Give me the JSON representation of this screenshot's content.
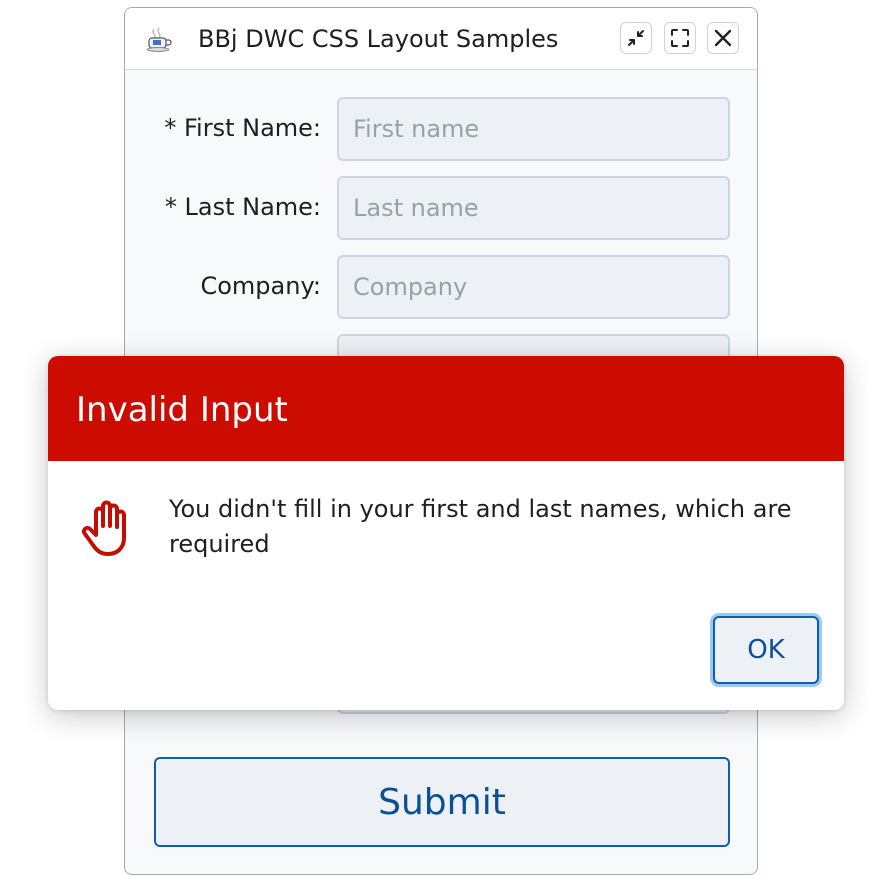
{
  "window": {
    "title": "BBj DWC CSS Layout Samples",
    "app_icon": "coffee-cup-icon",
    "controls": [
      "minimize-icon",
      "fullscreen-icon",
      "close-icon"
    ]
  },
  "form": {
    "fields": [
      {
        "label": "* First Name:",
        "placeholder": "First name",
        "value": ""
      },
      {
        "label": "* Last Name:",
        "placeholder": "Last name",
        "value": ""
      },
      {
        "label": "Company:",
        "placeholder": "Company",
        "value": ""
      }
    ],
    "submit_label": "Submit"
  },
  "dialog": {
    "title": "Invalid Input",
    "icon": "stop-hand-icon",
    "message": "You didn't fill in your first and last names, which are required",
    "ok_label": "OK"
  },
  "colors": {
    "dialog_header": "#cc0c00",
    "accent": "#0b5fad",
    "focus_ring": "#9cc8f5",
    "input_bg": "#edf1f5"
  }
}
